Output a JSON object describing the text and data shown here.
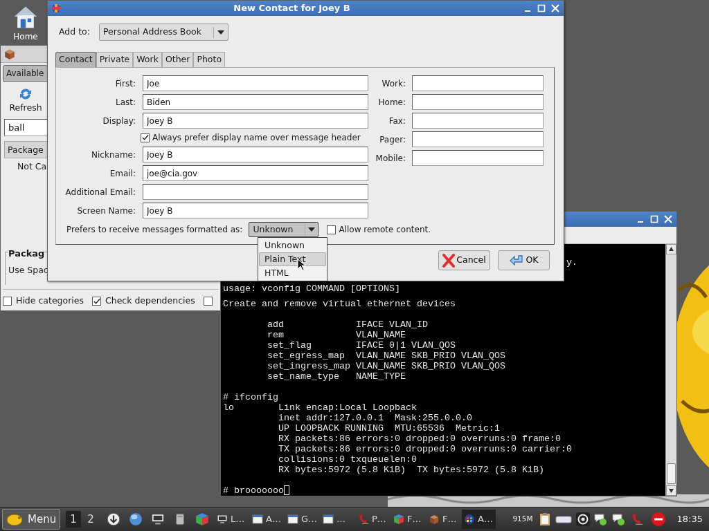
{
  "desktop_icons": [
    {
      "label": "Home"
    }
  ],
  "package_window": {
    "tab": "Available",
    "refresh": "Refresh",
    "search": "ball",
    "column": "Package",
    "cell": "Not Ca",
    "section_title": "Packag",
    "section_text": "Use Spac",
    "options": [
      {
        "label": "Hide categories",
        "checked": false
      },
      {
        "label": "Check dependencies",
        "checked": true
      },
      {
        "checked": false
      }
    ]
  },
  "terminal": {
    "partial_line": "y.",
    "blocks": [
      [
        "usage: vconfig COMMAND [OPTIONS]"
      ],
      [
        "Create and remove virtual ethernet devices"
      ],
      [
        "        add             IFACE VLAN_ID",
        "        rem             VLAN_NAME",
        "        set_flag        IFACE 0|1 VLAN_QOS",
        "        set_egress_map  VLAN_NAME SKB_PRIO VLAN_QOS",
        "        set_ingress_map VLAN_NAME SKB_PRIO VLAN_QOS",
        "        set_name_type   NAME_TYPE"
      ],
      [
        "# ifconfig",
        "lo        Link encap:Local Loopback",
        "          inet addr:127.0.0.1  Mask:255.0.0.0",
        "          UP LOOPBACK RUNNING  MTU:65536  Metric:1",
        "          RX packets:86 errors:0 dropped:0 overruns:0 frame:0",
        "          TX packets:86 errors:0 dropped:0 overruns:0 carrier:0",
        "          collisions:0 txqueuelen:0",
        "          RX bytes:5972 (5.8 KiB)  TX bytes:5972 (5.8 KiB)"
      ],
      [
        "# brooooooo"
      ]
    ]
  },
  "dialog": {
    "title": "New Contact for Joey B",
    "add_to": {
      "label": "Add to:",
      "value": "Personal Address Book"
    },
    "tabs": [
      {
        "label": "Contact",
        "selected": true
      },
      {
        "label": "Private",
        "selected": false
      },
      {
        "label": "Work",
        "selected": false
      },
      {
        "label": "Other",
        "selected": false
      },
      {
        "label": "Photo",
        "selected": false
      }
    ],
    "name_fields": [
      {
        "kind": "field",
        "label": "First:",
        "value": "Joe"
      },
      {
        "kind": "field",
        "label": "Last:",
        "value": "Biden"
      },
      {
        "kind": "field",
        "label": "Display:",
        "value": "Joey B"
      },
      {
        "kind": "checkbox",
        "label": "Always prefer display name over message header",
        "checked": true
      },
      {
        "kind": "field",
        "label": "Nickname:",
        "value": "Joey B"
      },
      {
        "kind": "field",
        "label": "Email:",
        "value": "joe@cia.gov"
      },
      {
        "kind": "field",
        "label": "Additional Email:"
      },
      {
        "kind": "field",
        "label": "Screen Name:",
        "value": "Joey B"
      }
    ],
    "phone_fields": [
      {
        "label": "Work:"
      },
      {
        "label": "Home:"
      },
      {
        "label": "Fax:"
      },
      {
        "label": "Pager:"
      },
      {
        "label": "Mobile:"
      }
    ],
    "format": {
      "label": "Prefers to receive messages formatted as:",
      "value": "Unknown",
      "options": [
        {
          "label": "Unknown",
          "highlighted": false
        },
        {
          "label": "Plain Text",
          "highlighted": true
        },
        {
          "label": "HTML",
          "highlighted": false
        }
      ]
    },
    "remote_content": {
      "label": "Allow remote content.",
      "checked": false
    },
    "buttons": [
      {
        "kind": "cancel",
        "label": "Cancel"
      },
      {
        "kind": "ok",
        "label": "OK"
      }
    ]
  },
  "taskbar": {
    "menu": "Menu",
    "workspaces": [
      {
        "label": "1",
        "selected": true
      },
      {
        "label": "2",
        "selected": false
      }
    ],
    "tasks": [
      {
        "kind": "monitor",
        "label": "L…",
        "selected": false
      },
      {
        "kind": "window",
        "label": "A…",
        "selected": false
      },
      {
        "kind": "window",
        "label": "G…",
        "selected": false
      },
      {
        "kind": "window",
        "label": "…",
        "selected": false
      },
      {
        "kind": "phone",
        "label": "P…",
        "selected": false
      },
      {
        "kind": "cube",
        "label": "F…",
        "selected": false
      },
      {
        "kind": "box",
        "label": "F…",
        "selected": false
      },
      {
        "kind": "badge",
        "label": "A…",
        "selected": true
      }
    ],
    "memory": "915M",
    "clock": "18:35"
  }
}
